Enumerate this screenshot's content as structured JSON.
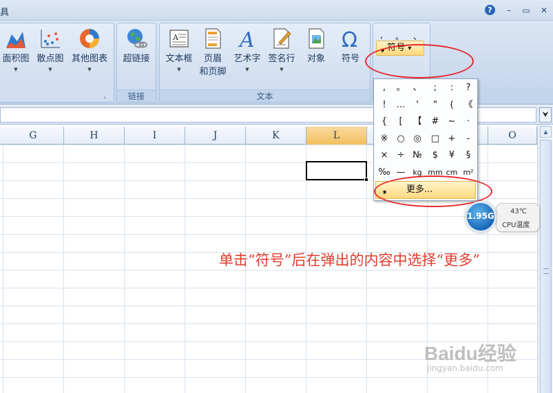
{
  "window": {
    "title_fragment": "具",
    "help_label": "?",
    "minimize_label": "–",
    "restore_label": "▭",
    "close_label": "✕"
  },
  "ribbon": {
    "charts_group": {
      "buttons": [
        {
          "label": "面积图",
          "icon": "area-chart-icon"
        },
        {
          "label": "散点图",
          "icon": "scatter-chart-icon"
        },
        {
          "label": "其他图表",
          "icon": "other-charts-icon"
        }
      ],
      "dropdown_arrow": "▼",
      "launcher": "⌞"
    },
    "links_group": {
      "label": "链接",
      "hyperlink_label": "超链接"
    },
    "text_group": {
      "label": "文本",
      "buttons": [
        {
          "label": "文本框",
          "icon": "text-box-icon"
        },
        {
          "label": "页眉",
          "label2": "和页脚",
          "icon": "header-footer-icon"
        },
        {
          "label": "艺术字",
          "icon": "wordart-icon"
        },
        {
          "label": "签名行",
          "icon": "signature-line-icon"
        },
        {
          "label": "对象",
          "icon": "object-icon"
        },
        {
          "label": "符号",
          "icon": "omega-symbol-icon"
        }
      ]
    },
    "special_symbols_group": {
      "quick_symbols": [
        ",",
        "。",
        "、",
        ";",
        ":",
        "?"
      ],
      "dropdown_label": "符号",
      "dropdown_bullet": "❟",
      "dropdown_arrow": "▾"
    }
  },
  "formula_bar": {
    "value": "",
    "expand_label": "⮟"
  },
  "sheet": {
    "columns": [
      "G",
      "H",
      "I",
      "J",
      "K",
      "L",
      "M",
      "N",
      "O"
    ],
    "selected_column": "L",
    "active_cell": "L3"
  },
  "symbol_panel": {
    "rows": [
      [
        ",",
        "。",
        "、",
        ";",
        ":",
        "?"
      ],
      [
        "!",
        "…",
        "'",
        "\"",
        "(",
        "《"
      ],
      [
        "{",
        "[",
        "【",
        "#",
        "~",
        "·"
      ],
      [
        "※",
        "○",
        "◎",
        "□",
        "+",
        "-"
      ],
      [
        "×",
        "÷",
        "№",
        "$",
        "¥",
        "§"
      ],
      [
        "‰",
        "—",
        "kg",
        "mm",
        "cm",
        "m²"
      ]
    ],
    "more_bullet": "❟",
    "more_label": "更多..."
  },
  "cpu_widget": {
    "value": "1.95G",
    "temperature": "43℃",
    "label": "CPU温度"
  },
  "annotation": {
    "caption": "单击“符号”后在弹出的内容中选择“更多”",
    "color": "#e8262b"
  },
  "watermark": {
    "brand": "Baidu经验",
    "site": "jingyan.baidu.com"
  }
}
